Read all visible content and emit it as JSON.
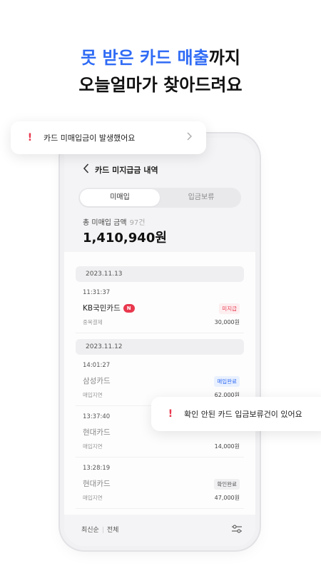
{
  "headline": {
    "line1_accent": "못 받은 카드 매출",
    "line1_rest": "까지",
    "line2": "오늘얼마가 찾아드려요"
  },
  "toasts": {
    "top": "카드 미매입금이 발생했어요",
    "bottom": "확인 안된 카드 입금보류건이 있어요"
  },
  "screen": {
    "title": "카드 미지급금 내역",
    "tabs": [
      "미매입",
      "입금보류"
    ],
    "active_tab": "미매입",
    "total_label": "총 미매입 금액",
    "total_count": "97건",
    "total_amount": "1,410,940원",
    "groups": [
      {
        "date": "2023.11.13",
        "items": [
          {
            "time": "11:31:37",
            "card": "KB국민카드",
            "new": "N",
            "status": "미지급",
            "status_type": "red",
            "sub": "중복결제",
            "amount": "30,000원"
          }
        ]
      },
      {
        "date": "2023.11.12",
        "items": [
          {
            "time": "14:01:27",
            "card": "삼성카드",
            "status": "매입완료",
            "status_type": "blue",
            "sub": "매입지연",
            "amount": "62,000원"
          },
          {
            "time": "13:37:40",
            "card": "현대카드",
            "status": "",
            "status_type": "",
            "sub": "매입지연",
            "amount": "14,000원"
          },
          {
            "time": "13:28:19",
            "card": "현대카드",
            "status": "확인완료",
            "status_type": "gray",
            "sub": "매입지연",
            "amount": "47,000원"
          }
        ]
      }
    ],
    "sort": "최신순",
    "filter_all": "전체"
  },
  "icons": {
    "back": "chevron-left-icon",
    "alert": "exclamation-icon",
    "toast_arrow": "chevron-right-icon",
    "filter": "filter-icon"
  },
  "colors": {
    "accent": "#2f6bf5",
    "alert": "#e9384e"
  }
}
